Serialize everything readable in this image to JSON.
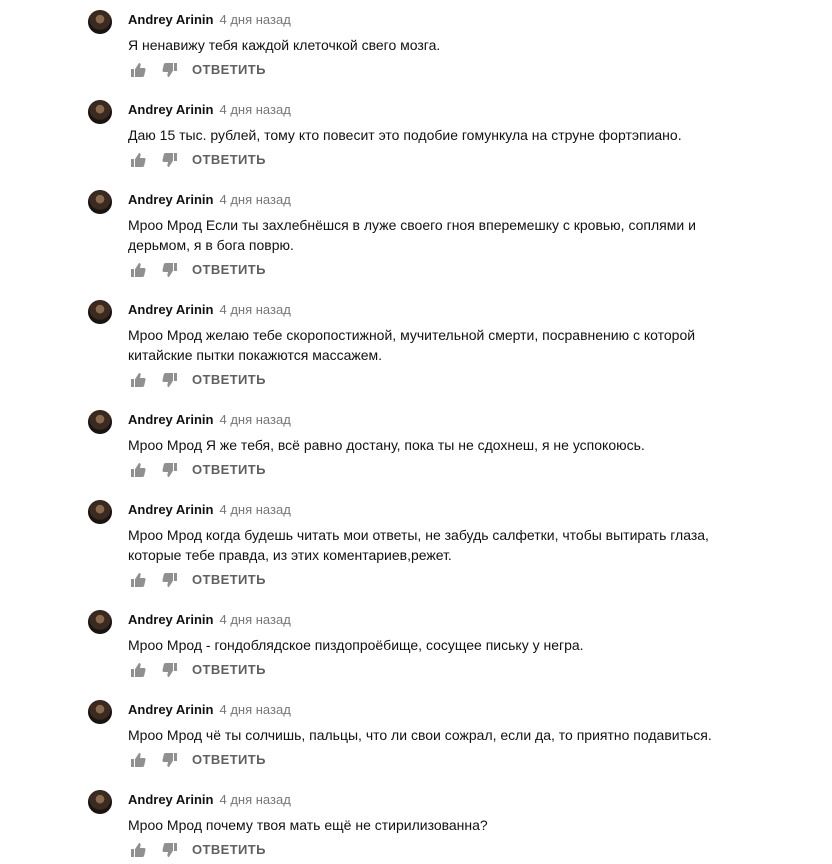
{
  "comments": [
    {
      "author": "Andrey Arinin",
      "time": "4 дня назад",
      "text": "Я ненавижу тебя каждой клеточкой свего мозга.",
      "reply": "ОТВЕТИТЬ"
    },
    {
      "author": "Andrey Arinin",
      "time": "4 дня назад",
      "text": "Даю 15 тыс. рублей, тому кто повесит это подобие гомункула на струне фортэпиано.",
      "reply": "ОТВЕТИТЬ"
    },
    {
      "author": "Andrey Arinin",
      "time": "4 дня назад",
      "text": "Мроо Мрод Если ты захлебнёшся в луже своего гноя вперемешку с кровью, соплями и дерьмом, я в бога поврю.",
      "reply": "ОТВЕТИТЬ"
    },
    {
      "author": "Andrey Arinin",
      "time": "4 дня назад",
      "text": "Мроо Мрод желаю тебе скоропостижной, мучительной смерти, посравнению с которой китайские пытки покажются массажем.",
      "reply": "ОТВЕТИТЬ"
    },
    {
      "author": "Andrey Arinin",
      "time": "4 дня назад",
      "text": "Мроо Мрод Я же тебя, всё равно достану, пока ты не сдохнеш, я не успокоюсь.",
      "reply": "ОТВЕТИТЬ"
    },
    {
      "author": "Andrey Arinin",
      "time": "4 дня назад",
      "text": "Мроо Мрод когда будешь читать мои ответы, не забудь салфетки, чтобы вытирать глаза, которые тебе правда, из этих коментариев,режет.",
      "reply": "ОТВЕТИТЬ"
    },
    {
      "author": "Andrey Arinin",
      "time": "4 дня назад",
      "text": "Мроо Мрод - гондоблядское пиздопроёбище, сосущее письку у негра.",
      "reply": "ОТВЕТИТЬ"
    },
    {
      "author": "Andrey Arinin",
      "time": "4 дня назад",
      "text": "Мроо Мрод чё ты солчишь, пальцы, что ли свои сожрал, если да, то приятно подавиться.",
      "reply": "ОТВЕТИТЬ"
    },
    {
      "author": "Andrey Arinin",
      "time": "4 дня назад",
      "text": "Мроо Мрод почему твоя мать ещё не стирилизованна?",
      "reply": "ОТВЕТИТЬ"
    }
  ]
}
